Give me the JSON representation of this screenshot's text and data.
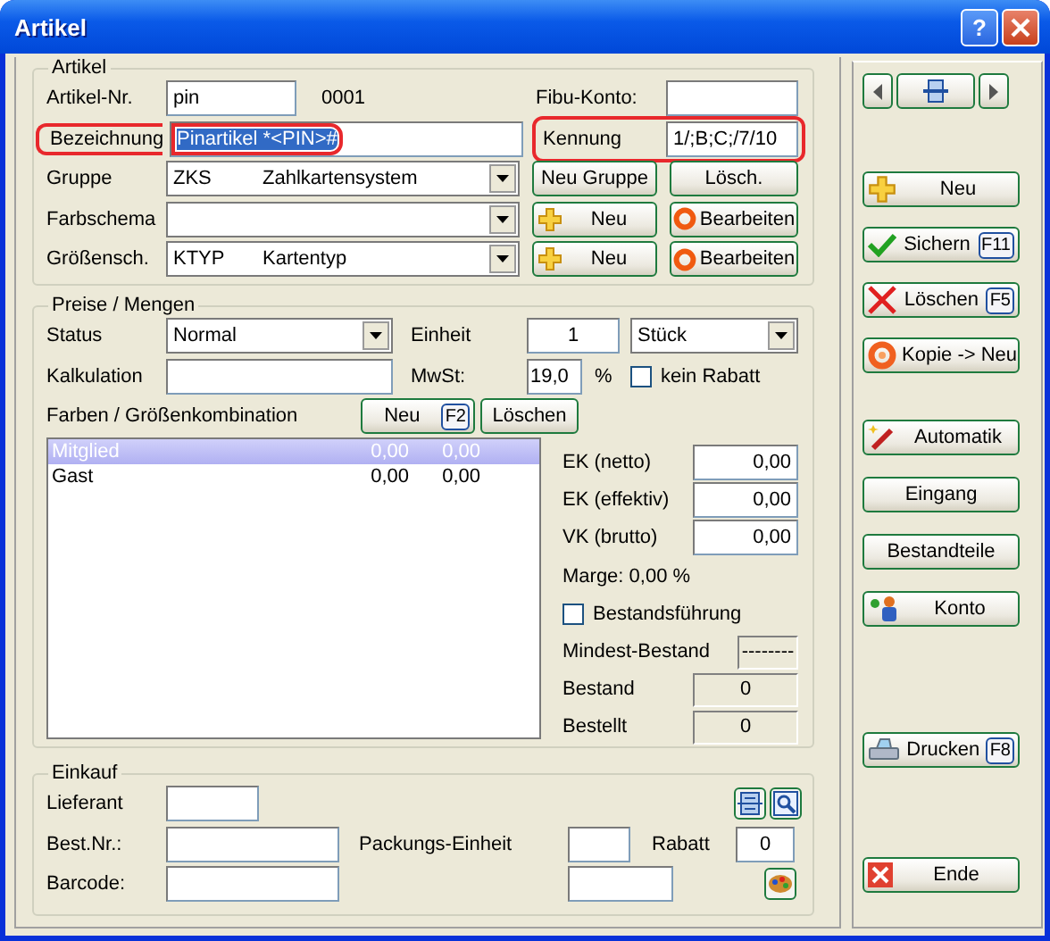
{
  "window": {
    "title": "Artikel",
    "help": "?"
  },
  "artikel": {
    "legend": "Artikel",
    "nr": {
      "label": "Artikel-Nr.",
      "value": "pin",
      "number": "0001"
    },
    "fibu": {
      "label": "Fibu-Konto:"
    },
    "bezeichnung": {
      "label": "Bezeichnung",
      "value": "Pinartikel *<PIN>#",
      "selected": true,
      "highlighted": true
    },
    "kennung": {
      "label": "Kennung",
      "value": "1/;B;C;/7/10",
      "highlighted": true
    },
    "combos": [
      {
        "label": "Gruppe",
        "code": "ZKS",
        "name": "Zahlkartensystem",
        "buttons": [
          {
            "label": "Neu Gruppe",
            "kind": "plain"
          },
          {
            "label": "Lösch.",
            "kind": "plain"
          }
        ]
      },
      {
        "label": "Farbschema",
        "buttons": [
          {
            "label": "Neu",
            "kind": "add"
          },
          {
            "label": "Bearbeiten",
            "kind": "edit"
          }
        ]
      },
      {
        "label": "Größensch.",
        "code": "KTYP",
        "name": "Kartentyp",
        "buttons": [
          {
            "label": "Neu",
            "kind": "add"
          },
          {
            "label": "Bearbeiten",
            "kind": "edit"
          }
        ]
      }
    ]
  },
  "preise": {
    "legend": "Preise / Mengen",
    "status": {
      "label": "Status",
      "value": "Normal"
    },
    "einheit": {
      "label": "Einheit",
      "value": "1",
      "unit": "Stück"
    },
    "kalkulation": {
      "label": "Kalkulation"
    },
    "mwst": {
      "label": "MwSt:",
      "value": "19,0",
      "suffix": "%"
    },
    "kein_rabatt": {
      "label": "kein Rabatt",
      "checked": false
    },
    "list_label": "Farben / Größenkombination",
    "list_buttons": [
      {
        "label": "Neu",
        "key": "F2"
      },
      {
        "label": "Löschen"
      }
    ],
    "rows": [
      {
        "name": "Mitglied",
        "col_2": "0,00",
        "col_3": "0,00",
        "selected": true
      },
      {
        "name": "Gast",
        "col_2": "0,00",
        "col_3": "0,00",
        "selected": false
      }
    ],
    "prices": [
      {
        "label": "EK (netto)",
        "value": "0,00"
      },
      {
        "label": "EK (effektiv)",
        "value": "0,00"
      },
      {
        "label": "VK (brutto)",
        "value": "0,00"
      }
    ],
    "marge": "Marge: 0,00 %",
    "bestandsfuehrung": {
      "label": "Bestandsführung",
      "checked": false
    },
    "stock": [
      {
        "label": "Mindest-Bestand",
        "value": "--------",
        "kind": "small"
      },
      {
        "label": "Bestand",
        "value": "0",
        "kind": "wide"
      },
      {
        "label": "Bestellt",
        "value": "0",
        "kind": "wide"
      }
    ]
  },
  "einkauf": {
    "legend": "Einkauf",
    "lieferant": {
      "label": "Lieferant"
    },
    "best_nr": {
      "label": "Best.Nr.:"
    },
    "packungs": {
      "label": "Packungs-Einheit"
    },
    "rabatt": {
      "label": "Rabatt",
      "value": "0"
    },
    "barcode": {
      "label": "Barcode:"
    }
  },
  "side": {
    "groups": [
      [
        {
          "label": "Neu",
          "kind": "add"
        },
        {
          "label": "Sichern",
          "kind": "save",
          "key": "F11"
        },
        {
          "label": "Löschen",
          "kind": "delete",
          "key": "F5"
        },
        {
          "label": "Kopie -> Neu",
          "kind": "copy"
        }
      ],
      [
        {
          "label": "Automatik",
          "kind": "auto"
        },
        {
          "label": "Eingang",
          "kind": "plain"
        },
        {
          "label": "Bestandteile",
          "kind": "plain"
        },
        {
          "label": "Konto",
          "kind": "account"
        }
      ],
      [
        {
          "label": "Drucken",
          "kind": "print",
          "key": "F8"
        }
      ],
      [
        {
          "label": "Ende",
          "kind": "exit"
        }
      ]
    ]
  }
}
